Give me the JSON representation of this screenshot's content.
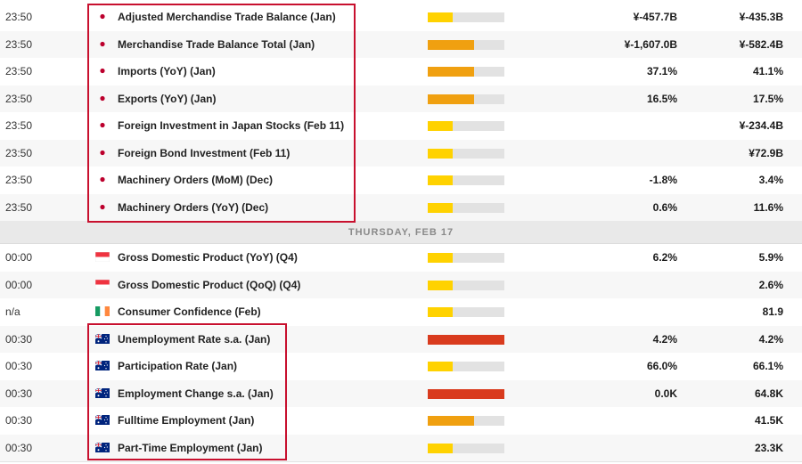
{
  "colors": {
    "highlight": "#c8102e",
    "impact_low": "#ffd200",
    "impact_medium": "#f0a010",
    "impact_high": "#d93b1e",
    "impact_track": "#e2e2e2"
  },
  "groups": [
    {
      "header": null,
      "rows": [
        {
          "time": "23:50",
          "flag": "jp-flag-icon",
          "event": "Adjusted Merchandise Trade Balance (Jan)",
          "impact": "low",
          "impact_level": 0.33,
          "actual": "¥-457.7B",
          "previous": "¥-435.3B"
        },
        {
          "time": "23:50",
          "flag": "jp-flag-icon",
          "event": "Merchandise Trade Balance Total (Jan)",
          "impact": "medium",
          "impact_level": 0.6,
          "actual": "¥-1,607.0B",
          "previous": "¥-582.4B"
        },
        {
          "time": "23:50",
          "flag": "jp-flag-icon",
          "event": "Imports (YoY) (Jan)",
          "impact": "medium",
          "impact_level": 0.6,
          "actual": "37.1%",
          "previous": "41.1%"
        },
        {
          "time": "23:50",
          "flag": "jp-flag-icon",
          "event": "Exports (YoY) (Jan)",
          "impact": "medium",
          "impact_level": 0.6,
          "actual": "16.5%",
          "previous": "17.5%"
        },
        {
          "time": "23:50",
          "flag": "jp-flag-icon",
          "event": "Foreign Investment in Japan Stocks (Feb 11)",
          "impact": "low",
          "impact_level": 0.33,
          "actual": "",
          "previous": "¥-234.4B"
        },
        {
          "time": "23:50",
          "flag": "jp-flag-icon",
          "event": "Foreign Bond Investment (Feb 11)",
          "impact": "low",
          "impact_level": 0.33,
          "actual": "",
          "previous": "¥72.9B"
        },
        {
          "time": "23:50",
          "flag": "jp-flag-icon",
          "event": "Machinery Orders (MoM) (Dec)",
          "impact": "low",
          "impact_level": 0.33,
          "actual": "-1.8%",
          "previous": "3.4%"
        },
        {
          "time": "23:50",
          "flag": "jp-flag-icon",
          "event": "Machinery Orders (YoY) (Dec)",
          "impact": "low",
          "impact_level": 0.33,
          "actual": "0.6%",
          "previous": "11.6%"
        }
      ]
    },
    {
      "header": "THURSDAY, FEB 17",
      "rows": [
        {
          "time": "00:00",
          "flag": "sg-flag-icon",
          "event": "Gross Domestic Product (YoY) (Q4)",
          "impact": "low",
          "impact_level": 0.33,
          "actual": "6.2%",
          "previous": "5.9%"
        },
        {
          "time": "00:00",
          "flag": "sg-flag-icon",
          "event": "Gross Domestic Product (QoQ) (Q4)",
          "impact": "low",
          "impact_level": 0.33,
          "actual": "",
          "previous": "2.6%"
        },
        {
          "time": "n/a",
          "flag": "ie-flag-icon",
          "event": "Consumer Confidence (Feb)",
          "impact": "low",
          "impact_level": 0.33,
          "actual": "",
          "previous": "81.9"
        },
        {
          "time": "00:30",
          "flag": "au-flag-icon",
          "event": "Unemployment Rate s.a. (Jan)",
          "impact": "high",
          "impact_level": 1.0,
          "actual": "4.2%",
          "previous": "4.2%"
        },
        {
          "time": "00:30",
          "flag": "au-flag-icon",
          "event": "Participation Rate (Jan)",
          "impact": "low",
          "impact_level": 0.33,
          "actual": "66.0%",
          "previous": "66.1%"
        },
        {
          "time": "00:30",
          "flag": "au-flag-icon",
          "event": "Employment Change s.a. (Jan)",
          "impact": "high",
          "impact_level": 1.0,
          "actual": "0.0K",
          "previous": "64.8K"
        },
        {
          "time": "00:30",
          "flag": "au-flag-icon",
          "event": "Fulltime Employment (Jan)",
          "impact": "medium",
          "impact_level": 0.6,
          "actual": "",
          "previous": "41.5K"
        },
        {
          "time": "00:30",
          "flag": "au-flag-icon",
          "event": "Part-Time Employment (Jan)",
          "impact": "low",
          "impact_level": 0.33,
          "actual": "",
          "previous": "23.3K"
        }
      ]
    }
  ]
}
